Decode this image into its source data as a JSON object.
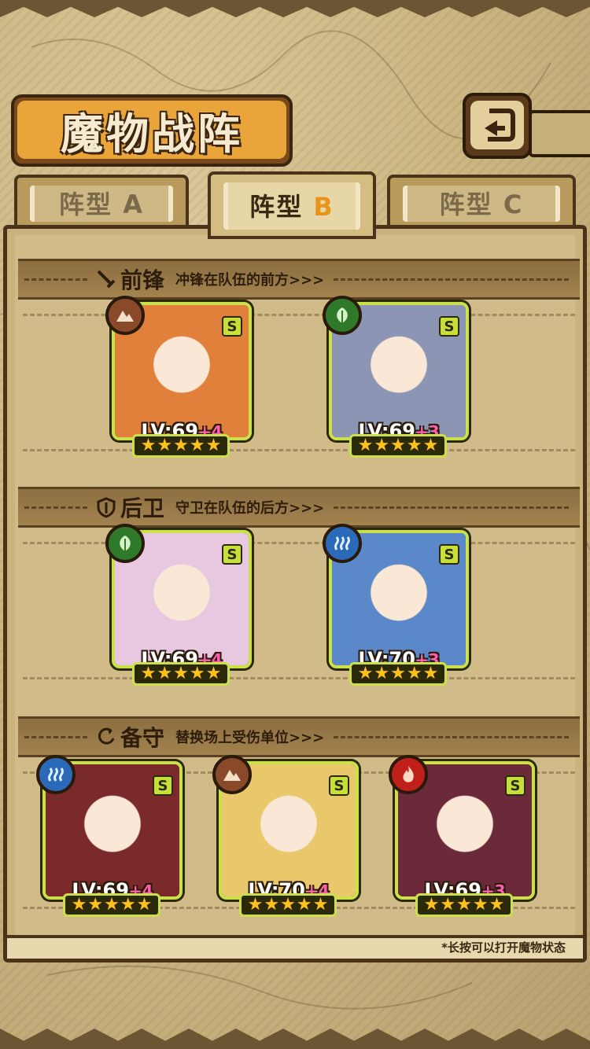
{
  "header": {
    "title": "魔物战阵"
  },
  "tabs": [
    {
      "prefix": "阵型",
      "letter": "A"
    },
    {
      "prefix": "阵型",
      "letter": "B"
    },
    {
      "prefix": "阵型",
      "letter": "C"
    }
  ],
  "active_tab": "B",
  "sections": {
    "vanguard": {
      "title": "前锋",
      "desc": "冲锋在队伍的前方>>>"
    },
    "rear": {
      "title": "后卫",
      "desc": "守卫在队伍的后方>>>"
    },
    "reserve": {
      "title": "备守",
      "desc": "替换场上受伤单位>>>"
    }
  },
  "units": [
    {
      "element": "earth",
      "rank": "S",
      "level": "LV:69",
      "bonus": "+4",
      "stars": 5,
      "elem_color": "#8a4a2a",
      "bg": "#e0803a"
    },
    {
      "element": "leaf",
      "rank": "S",
      "level": "LV:69",
      "bonus": "+3",
      "stars": 5,
      "elem_color": "#2f7a2a",
      "bg": "#8c96b4"
    },
    {
      "element": "leaf",
      "rank": "S",
      "level": "LV:69",
      "bonus": "+4",
      "stars": 5,
      "elem_color": "#2f7a2a",
      "bg": "#e8c8e0"
    },
    {
      "element": "water",
      "rank": "S",
      "level": "LV:70",
      "bonus": "+3",
      "stars": 5,
      "elem_color": "#2a6ab8",
      "bg": "#5a88c8"
    },
    {
      "element": "water",
      "rank": "S",
      "level": "LV:69",
      "bonus": "+4",
      "stars": 5,
      "elem_color": "#2a6ab8",
      "bg": "#7a2a2a"
    },
    {
      "element": "earth",
      "rank": "S",
      "level": "LV:70",
      "bonus": "+4",
      "stars": 5,
      "elem_color": "#8a4a2a",
      "bg": "#e8c86a"
    },
    {
      "element": "fire",
      "rank": "S",
      "level": "LV:69",
      "bonus": "+3",
      "stars": 5,
      "elem_color": "#c0201a",
      "bg": "#6a2a3a"
    }
  ],
  "footer": {
    "hint": "*长按可以打开魔物状态"
  }
}
